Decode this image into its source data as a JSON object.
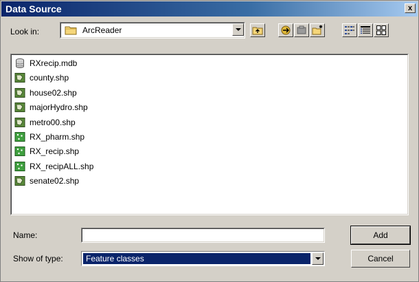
{
  "window": {
    "title": "Data Source",
    "close_glyph": "x"
  },
  "look_in": {
    "label": "Look in:",
    "value": "ArcReader",
    "icon": "folder-icon"
  },
  "toolbar": {
    "buttons": [
      {
        "name": "up-one-level",
        "icon": "up-folder-icon"
      },
      {
        "name": "connect-to-folder",
        "icon": "connect-folder-icon"
      },
      {
        "name": "disconnect-folder",
        "icon": "disconnect-folder-icon"
      },
      {
        "name": "new-folder",
        "icon": "new-folder-icon"
      },
      {
        "name": "list-view",
        "icon": "list-view-icon"
      },
      {
        "name": "details-view",
        "icon": "details-view-icon"
      },
      {
        "name": "thumbnails-view",
        "icon": "thumbnails-view-icon"
      }
    ]
  },
  "files": [
    {
      "name": "RXrecip.mdb",
      "type": "database"
    },
    {
      "name": "county.shp",
      "type": "polygon-shapefile"
    },
    {
      "name": "house02.shp",
      "type": "polygon-shapefile"
    },
    {
      "name": "majorHydro.shp",
      "type": "polygon-shapefile"
    },
    {
      "name": "metro00.shp",
      "type": "polygon-shapefile"
    },
    {
      "name": "RX_pharm.shp",
      "type": "point-shapefile"
    },
    {
      "name": "RX_recip.shp",
      "type": "point-shapefile"
    },
    {
      "name": "RX_recipALL.shp",
      "type": "point-shapefile"
    },
    {
      "name": "senate02.shp",
      "type": "polygon-shapefile"
    }
  ],
  "name_field": {
    "label": "Name:",
    "value": ""
  },
  "type_field": {
    "label": "Show of type:",
    "value": "Feature classes"
  },
  "buttons": {
    "add_label": "Add",
    "cancel_label": "Cancel"
  },
  "colors": {
    "title_bar": "#0a246a",
    "selection": "#0a246a",
    "dialog_bg": "#d4d0c8",
    "polygon_icon": "#5a8a3a",
    "point_icon": "#3fa03f"
  }
}
